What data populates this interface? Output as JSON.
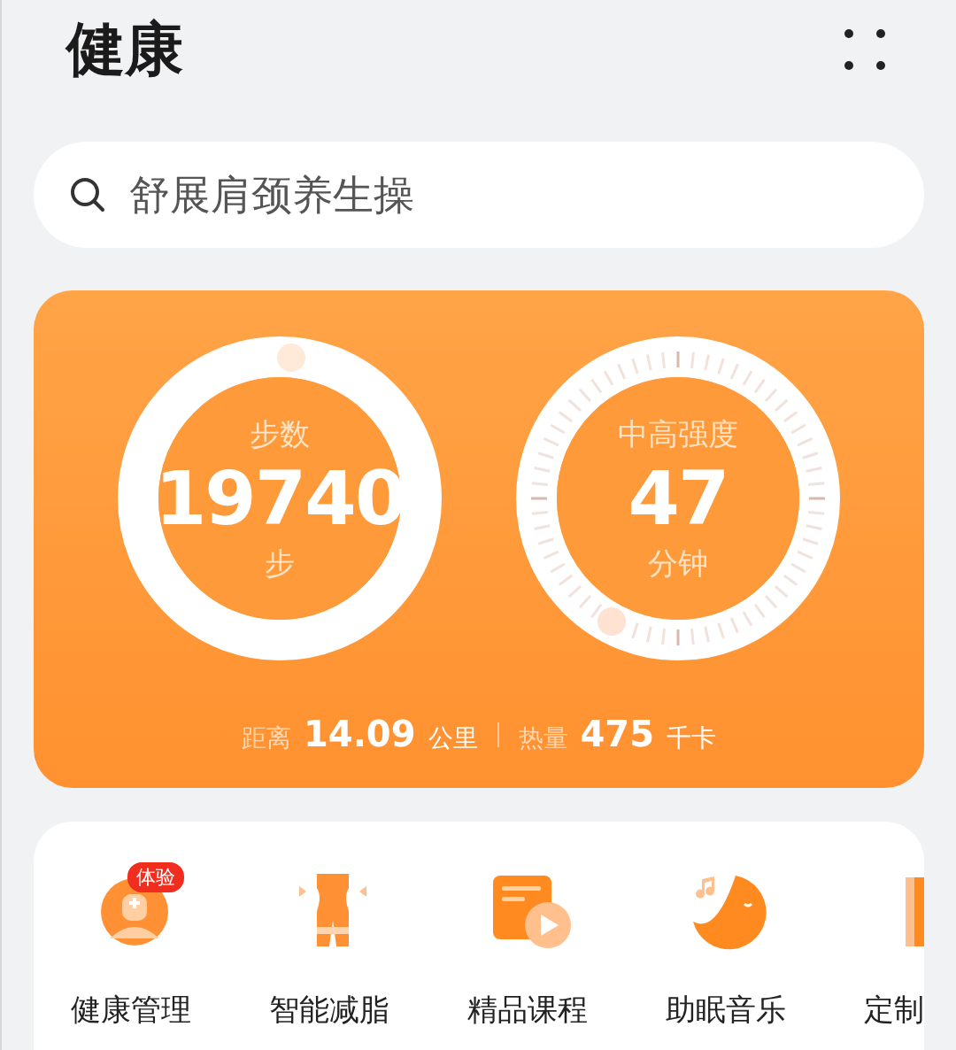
{
  "header": {
    "title": "健康"
  },
  "search": {
    "placeholder": "舒展肩颈养生操"
  },
  "summary": {
    "rings": [
      {
        "kind": "progress",
        "label": "步数",
        "value": "19740",
        "unit": "步"
      },
      {
        "kind": "dial",
        "label": "中高强度",
        "value": "47",
        "unit": "分钟"
      }
    ],
    "stats": [
      {
        "label": "距离",
        "value": "14.09",
        "unit": "公里"
      },
      {
        "label": "热量",
        "value": "475",
        "unit": "千卡"
      }
    ]
  },
  "services": [
    {
      "kind": "doctor",
      "label": "健康管理",
      "badge": "体验"
    },
    {
      "kind": "waist",
      "label": "智能减脂"
    },
    {
      "kind": "course",
      "label": "精品课程"
    },
    {
      "kind": "sleep",
      "label": "助眠音乐"
    },
    {
      "kind": "book",
      "label": "定制"
    }
  ]
}
